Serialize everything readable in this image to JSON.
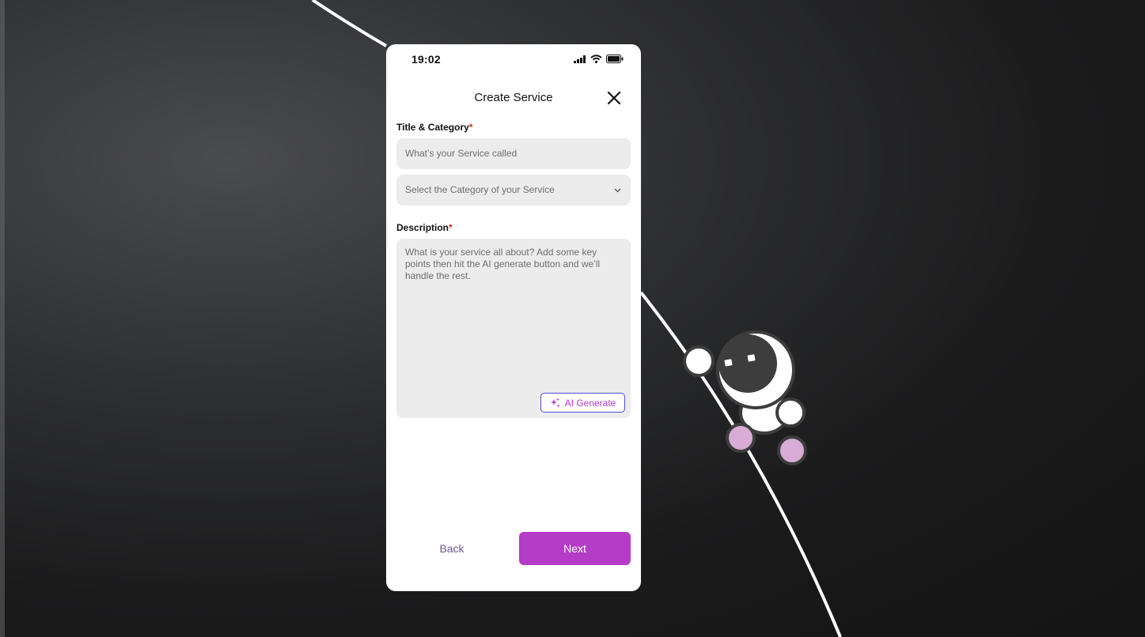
{
  "status_bar": {
    "time": "19:02"
  },
  "header": {
    "title": "Create Service",
    "close_icon": "close-icon"
  },
  "title_category": {
    "label": "Title & Category",
    "required_mark": "*",
    "title_placeholder": "What’s your Service called",
    "category_placeholder": "Select the Category of your Service"
  },
  "description": {
    "label": "Description",
    "required_mark": "*",
    "placeholder": "What is your service all about? Add some key points then hit the AI generate button and we’ll handle the rest.",
    "ai_button_label": "AI Generate",
    "ai_icon": "sparkle-icon"
  },
  "footer": {
    "back_label": "Back",
    "next_label": "Next"
  },
  "colors": {
    "accent": "#b53cc6",
    "ai_border": "#4c4fd8",
    "required": "#e2231a",
    "field_bg": "#ececec",
    "astronaut_pads": "#d8acd6"
  }
}
